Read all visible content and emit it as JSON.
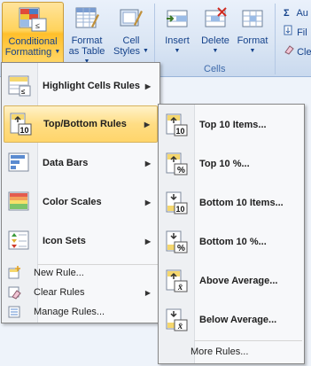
{
  "ribbon": {
    "conditional_formatting": {
      "line1": "Conditional",
      "line2": "Formatting"
    },
    "format_as_table": {
      "line1": "Format",
      "line2": "as Table"
    },
    "cell_styles": {
      "line1": "Cell",
      "line2": "Styles"
    },
    "insert": {
      "label": "Insert"
    },
    "delete": {
      "label": "Delete"
    },
    "format": {
      "label": "Format"
    },
    "cells_group_label": "Cells",
    "autosum_partial": "Au",
    "fill_partial": "Fil",
    "clear_partial": "Cle",
    "sigma_glyph": "Σ"
  },
  "menu": {
    "items": [
      {
        "label": "Highlight Cells Rules",
        "icon": "highlight-cells-icon",
        "has_submenu": true
      },
      {
        "label": "Top/Bottom Rules",
        "icon": "top-bottom-icon",
        "has_submenu": true,
        "highlighted": true
      },
      {
        "label": "Data Bars",
        "icon": "data-bars-icon",
        "has_submenu": true
      },
      {
        "label": "Color Scales",
        "icon": "color-scales-icon",
        "has_submenu": true
      },
      {
        "label": "Icon Sets",
        "icon": "icon-sets-icon",
        "has_submenu": true
      }
    ],
    "small_items": [
      {
        "label": "New Rule...",
        "icon": "new-rule-icon"
      },
      {
        "label": "Clear Rules",
        "icon": "clear-rules-icon",
        "has_submenu": true
      },
      {
        "label": "Manage Rules...",
        "icon": "manage-rules-icon"
      }
    ]
  },
  "submenu": {
    "items": [
      {
        "label": "Top 10 Items...",
        "icon_text": "10",
        "direction": "up"
      },
      {
        "label": "Top 10 %...",
        "icon_text": "%",
        "direction": "up"
      },
      {
        "label": "Bottom 10 Items...",
        "icon_text": "10",
        "direction": "down"
      },
      {
        "label": "Bottom 10 %...",
        "icon_text": "%",
        "direction": "down"
      },
      {
        "label": "Above Average...",
        "icon_text": "x̄",
        "direction": "up"
      },
      {
        "label": "Below Average...",
        "icon_text": "x̄",
        "direction": "down"
      }
    ],
    "more_rules": "More Rules..."
  },
  "colors": {
    "accent": "#ffd35c",
    "ribbon_text": "#15428b",
    "menu_border": "#868686"
  }
}
